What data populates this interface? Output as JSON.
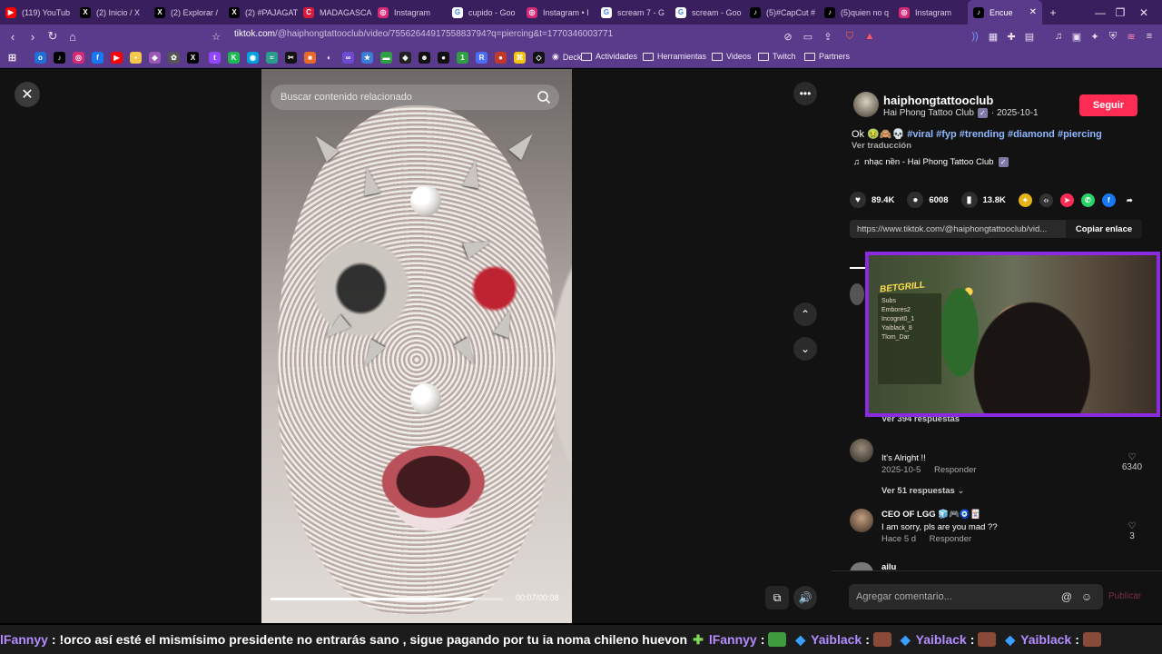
{
  "tabs": [
    {
      "label": "(119) YouTub",
      "icon": "youtube-icon",
      "color": "#ff0000"
    },
    {
      "label": "(2) Inicio / X",
      "icon": "x-icon",
      "color": "#000000"
    },
    {
      "label": "(2) Explorar /",
      "icon": "x-icon",
      "color": "#000000"
    },
    {
      "label": "(2) #PAJAGAT",
      "icon": "x-icon",
      "color": "#000000"
    },
    {
      "label": "MADAGASCA",
      "icon": "c-icon",
      "color": "#d81b3a"
    },
    {
      "label": "Instagram",
      "icon": "instagram-icon",
      "color": "#d62976"
    },
    {
      "label": "cupido - Goo",
      "icon": "google-icon",
      "color": "#ffffff"
    },
    {
      "label": "Instagram • I",
      "icon": "instagram-icon",
      "color": "#d62976"
    },
    {
      "label": "scream 7 - G",
      "icon": "google-icon",
      "color": "#ffffff"
    },
    {
      "label": "scream - Goo",
      "icon": "google-icon",
      "color": "#ffffff"
    },
    {
      "label": "(5)#CapCut #",
      "icon": "tiktok-icon",
      "color": "#000000"
    },
    {
      "label": "(5)quien no q",
      "icon": "tiktok-icon",
      "color": "#000000"
    },
    {
      "label": "Instagram",
      "icon": "instagram-icon",
      "color": "#d62976"
    },
    {
      "label": "Encue",
      "icon": "tiktok-icon",
      "color": "#000000",
      "active": true
    }
  ],
  "url": {
    "host": "tiktok.com",
    "path": "/@haiphongtattooclub/video/7556264491755883794?q=piercing&t=1770346003771"
  },
  "bookmarks": {
    "folders": [
      "Deck",
      "Actividades",
      "Herramientas",
      "Videos",
      "Twitch",
      "Partners"
    ]
  },
  "video": {
    "search_placeholder": "Buscar contenido relacionado",
    "time": "00:07/00:08",
    "progress": 0.875
  },
  "author": {
    "username": "haiphongtattooclub",
    "display_name": "Hai Phong Tattoo Club",
    "date": "· 2025-10-1",
    "follow_label": "Seguir"
  },
  "caption": {
    "text": "Ok 🤢🙈💀",
    "tags": [
      "#viral",
      "#fyp",
      "#trending",
      "#diamond",
      "#piercing"
    ],
    "translate_label": "Ver traducción"
  },
  "music": "nhạc nền - Hai Phong Tattoo Club",
  "stats": {
    "likes": "89.4K",
    "comments": "6008",
    "saves": "13.8K"
  },
  "link": {
    "text": "https://www.tiktok.com/@haiphongtattooclub/vid...",
    "copy_label": "Copiar enlace"
  },
  "webcam": {
    "sign": "BETGRILL",
    "board_lines": [
      "Subs",
      "Embores2",
      "Incognit0_1",
      "Yaiblack_8",
      "Tlom_Dar"
    ]
  },
  "comments": [
    {
      "name": "",
      "text": "It's Alright !!",
      "date": "2025-10-5",
      "reply_label": "Responder",
      "likes": "6340",
      "replies_label": "Ver 51 respuestas",
      "prev_replies": "Ver 394 respuestas"
    },
    {
      "name": "CEO OF LGG 🧊🎮🧿🃏",
      "text": "I am sorry, pls are you mad ??",
      "date": "Hace 5 d",
      "reply_label": "Responder",
      "likes": "3"
    },
    {
      "name": "ailu",
      "text": ""
    }
  ],
  "comment_box": {
    "placeholder": "Agregar comentario...",
    "post_label": "Publicar"
  },
  "ticker": [
    {
      "user": "lFannyy",
      "msg": ": !orco así esté el mismísimo presidente no entrarás sano , sigue pagando por tu ia noma chileno huevon"
    },
    {
      "user": "lFannyy",
      "msg": ":"
    },
    {
      "user": "Yaiblack",
      "msg": ":"
    },
    {
      "user": "Yaiblack",
      "msg": ":"
    },
    {
      "user": "Yaiblack",
      "msg": ":"
    }
  ],
  "colors": {
    "accent": "#fe2c55",
    "browser": "#5a3a8a",
    "webcam_border": "#8a2be2"
  }
}
